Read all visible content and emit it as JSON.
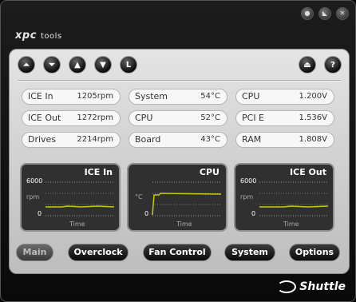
{
  "app": {
    "logo": "xpc",
    "logo_sub": "tools",
    "brand": "Shuttle"
  },
  "window_controls": {
    "close_symbol": "●",
    "minimize_symbol": "◣",
    "exit_symbol": "✕"
  },
  "toolbar": [
    {
      "id": "top",
      "symbol": "⏶"
    },
    {
      "id": "bottom",
      "symbol": "⏷"
    },
    {
      "id": "up",
      "symbol": "▲"
    },
    {
      "id": "down",
      "symbol": "▼"
    },
    {
      "id": "lock",
      "symbol": "L"
    },
    {
      "id": "eject",
      "symbol": "⏏"
    },
    {
      "id": "help",
      "symbol": "?"
    }
  ],
  "stats": {
    "fans": [
      {
        "label": "ICE In",
        "value": "1205rpm"
      },
      {
        "label": "ICE Out",
        "value": "1272rpm"
      },
      {
        "label": "Drives",
        "value": "2214rpm"
      }
    ],
    "temps": [
      {
        "label": "System",
        "value": "54°C"
      },
      {
        "label": "CPU",
        "value": "52°C"
      },
      {
        "label": "Board",
        "value": "43°C"
      }
    ],
    "voltages": [
      {
        "label": "CPU",
        "value": "1.200V"
      },
      {
        "label": "PCI E",
        "value": "1.536V"
      },
      {
        "label": "RAM",
        "value": "1.808V"
      }
    ]
  },
  "graphs": [
    {
      "title": "ICE In",
      "max": "6000",
      "unit": "rpm",
      "min": "0",
      "x": "Time"
    },
    {
      "title": "CPU",
      "max": "",
      "unit": "°C",
      "min": "0",
      "x": "Time"
    },
    {
      "title": "ICE Out",
      "max": "6000",
      "unit": "rpm",
      "min": "0",
      "x": "Time"
    }
  ],
  "nav": [
    {
      "label": "Main",
      "active": true
    },
    {
      "label": "Overclock"
    },
    {
      "label": "Fan Control"
    },
    {
      "label": "System"
    },
    {
      "label": "Options"
    }
  ],
  "colors": {
    "trace": "#c8c81a",
    "panel": "#d6d6d6"
  }
}
